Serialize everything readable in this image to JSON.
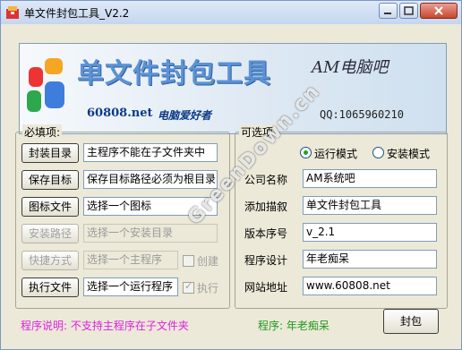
{
  "window": {
    "title": "单文件封包工具_V2.2"
  },
  "banner": {
    "title": "单文件封包工具",
    "site": "60808.net",
    "slogan": "电脑爱好者",
    "brand": "AM电脑吧",
    "qq": "QQ:1065960210"
  },
  "required": {
    "legend": "必填项:",
    "rows": [
      {
        "button": "封装目录",
        "value": "主程序不能在子文件夹中"
      },
      {
        "button": "保存目标",
        "value": "保存目标路径必须为根目录"
      },
      {
        "button": "图标文件",
        "value": "选择一个图标"
      },
      {
        "button": "安装路径",
        "value": "选择一个安装目录"
      },
      {
        "button": "快捷方式",
        "value": "选择一个主程序",
        "check": "创建"
      },
      {
        "button": "执行文件",
        "value": "选择一个运行程序",
        "check": "执行"
      }
    ]
  },
  "optional": {
    "legend": "可选项:",
    "mode_run": "运行模式",
    "mode_install": "安装模式",
    "fields": [
      {
        "label": "公司名称",
        "value": "AM系统吧"
      },
      {
        "label": "添加描叙",
        "value": "单文件封包工具"
      },
      {
        "label": "版本序号",
        "value": "v_2.1"
      },
      {
        "label": "程序设计",
        "value": "年老痴呆"
      },
      {
        "label": "网站地址",
        "value": "www.60808.net"
      }
    ]
  },
  "footer": {
    "note": "程序说明: 不支持主程序在子文件夹",
    "author": "程序: 年老痴呆",
    "pack_button": "封包"
  },
  "watermark": "GreenDown.cn",
  "colors": {
    "note": "#e020e0",
    "author": "#1e9a1e",
    "radio_on": "#21a121"
  }
}
